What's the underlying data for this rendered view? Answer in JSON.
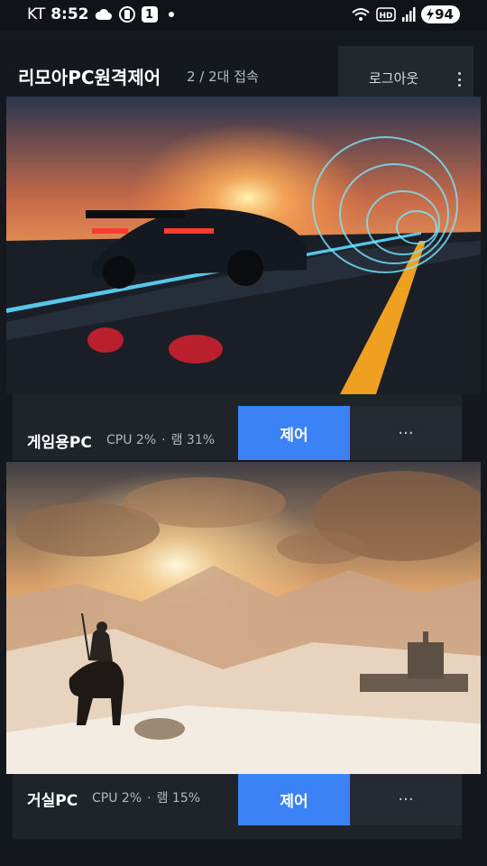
{
  "status_bar": {
    "carrier": "KT",
    "time": "8:52",
    "notification_count": "1",
    "hd_label": "HD",
    "battery": "94"
  },
  "header": {
    "title": "리모아PC원격제어",
    "connection_status": "2 / 2대 접속",
    "logout_label": "로그아웃"
  },
  "pcs": [
    {
      "name": "게임용PC",
      "cpu": "CPU 2%",
      "ram": "램 31%",
      "separator": "·",
      "control_label": "제어",
      "more_label": "···"
    },
    {
      "name": "거실PC",
      "cpu": "CPU 2%",
      "ram": "램 15%",
      "separator": "·",
      "control_label": "제어",
      "more_label": "···"
    }
  ],
  "colors": {
    "background": "#15191f",
    "card": "#1f242b",
    "accent": "#3b82f6"
  }
}
